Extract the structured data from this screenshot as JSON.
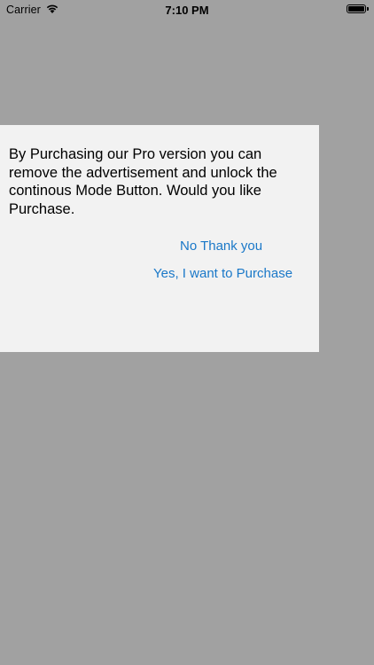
{
  "status_bar": {
    "carrier": "Carrier",
    "time": "7:10 PM",
    "wifi_icon": "wifi-icon",
    "battery_icon": "battery-icon",
    "battery_level": 1.0
  },
  "dialog": {
    "message": "By Purchasing our Pro version you can remove the advertisement and unlock the continous Mode Button. Would you like Purchase.",
    "no_button": "No Thank you",
    "yes_button": "Yes, I want to Purchase",
    "button_color": "#1a78c8",
    "background": "#f2f2f2"
  },
  "overlay_color": "#a1a1a1"
}
